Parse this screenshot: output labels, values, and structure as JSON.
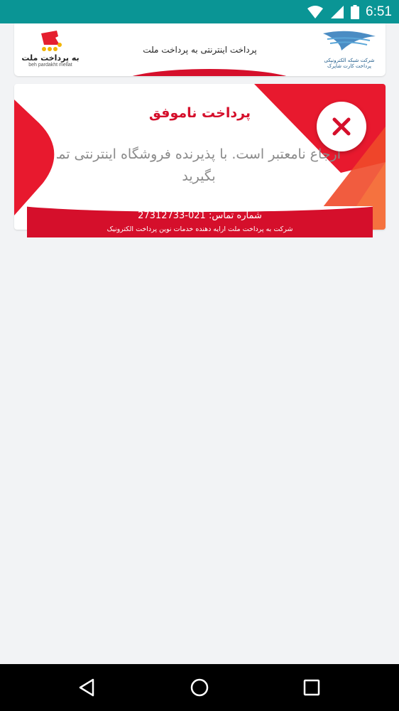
{
  "status_bar": {
    "time": "6:51",
    "icons": [
      "wifi-icon",
      "signal-icon",
      "battery-icon"
    ]
  },
  "header": {
    "title": "پرداخت اینترنتی به پرداخت ملت",
    "left_logo": {
      "text": "به پرداخت ملت",
      "subtext": "beh pardakht mellat"
    },
    "right_logo": {
      "text": "شرکت شبکه الکترونیکی پرداخت کارت شاپرک"
    }
  },
  "result": {
    "title": "پرداخت ناموفق",
    "message_line1": "ارجاع نامعتبر است. با پذیرنده فروشگاه اینترنتی تماس",
    "message_line2": "بگیرید",
    "contact_phone": "شماره تماس: 021-27312733",
    "company_line": "شرکت به پرداخت ملت ارایه دهنده خدمات نوین پرداخت الکترونیک"
  },
  "colors": {
    "status_bar": "#0a9595",
    "brand_red": "#d50f2b",
    "background": "#f2f3f5",
    "message_gray": "#8a8a8a"
  },
  "nav": {
    "buttons": [
      "back-icon",
      "home-icon",
      "recents-icon"
    ]
  }
}
